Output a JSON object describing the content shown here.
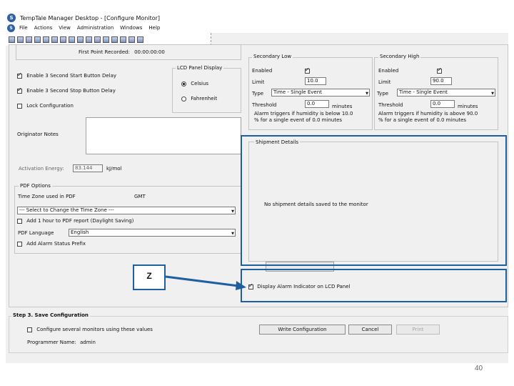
{
  "window": {
    "title": "TempTale Manager Desktop - [Configure Monitor]",
    "logo_text": "S"
  },
  "menu": {
    "items": [
      "File",
      "Actions",
      "View",
      "Administration",
      "Windows",
      "Help"
    ]
  },
  "toolbar": {
    "icons": [
      "new-icon",
      "open-icon",
      "save-icon",
      "print-icon",
      "cut-icon",
      "copy-icon",
      "paste-icon",
      "monitor-icon",
      "report-icon",
      "table-icon",
      "zoom-icon",
      "globe-icon",
      "chart-icon",
      "user-icon",
      "mail-icon",
      "help-icon"
    ]
  },
  "first_point": {
    "label": "First Point Recorded:",
    "value": "00:00:00:00"
  },
  "options": {
    "start_delay": {
      "label": "Enable 3 Second Start Button Delay",
      "checked": true
    },
    "stop_delay": {
      "label": "Enable 3 Second Stop Button Delay",
      "checked": true
    },
    "lock": {
      "label": "Lock Configuration",
      "checked": false
    }
  },
  "lcd_display": {
    "title": "LCD Panel Display",
    "celsius": "Celsius",
    "fahrenheit": "Fahrenheit",
    "selected": "Celsius"
  },
  "originator_notes": {
    "label": "Originator Notes",
    "value": ""
  },
  "activation_energy": {
    "label": "Activation Energy:",
    "value": "83.144",
    "unit": "kJ/mol"
  },
  "pdf_options": {
    "title": "PDF Options",
    "tz_label": "Time Zone used in PDF",
    "tz_value": "GMT",
    "tz_select": "--- Select to Change the Time Zone ---",
    "dst": {
      "label": "Add 1 hour to PDF report (Daylight Saving)",
      "checked": false
    },
    "lang_label": "PDF Language",
    "lang_value": "English",
    "alarm_prefix": {
      "label": "Add Alarm Status Prefix",
      "checked": false
    }
  },
  "secondary_low": {
    "title": "Secondary Low",
    "enabled_label": "Enabled",
    "enabled": true,
    "limit_label": "Limit",
    "limit": "10.0",
    "type_label": "Type",
    "type": "Time - Single Event",
    "threshold_label": "Threshold",
    "threshold": "0.0",
    "threshold_unit": "minutes",
    "note1": "Alarm triggers if humidity is below 10.0",
    "note2": "% for a single event of 0.0 minutes"
  },
  "secondary_high": {
    "title": "Secondary High",
    "enabled_label": "Enabled",
    "enabled": true,
    "limit_label": "Limit",
    "limit": "90.0",
    "type_label": "Type",
    "type": "Time - Single Event",
    "threshold_label": "Threshold",
    "threshold": "0.0",
    "threshold_unit": "minutes",
    "note1": "Alarm triggers if humidity is above 90.0",
    "note2": "% for a single event of 0.0 minutes"
  },
  "shipment": {
    "title": "Shipment Details",
    "empty_text": "No shipment details saved to the monitor"
  },
  "alarm_indicator": {
    "label": "Display Alarm Indicator on LCD Panel",
    "checked": true
  },
  "step3": {
    "title": "Step 3. Save Configuration",
    "multi": {
      "label": "Configure several monitors using these values",
      "checked": false
    },
    "programmer_label": "Programmer Name:",
    "programmer": "admin",
    "write": "Write Configuration",
    "cancel": "Cancel",
    "print": "Print"
  },
  "annotation": {
    "label": "Z",
    "color": "#1f5f9f"
  },
  "page_number": "40"
}
